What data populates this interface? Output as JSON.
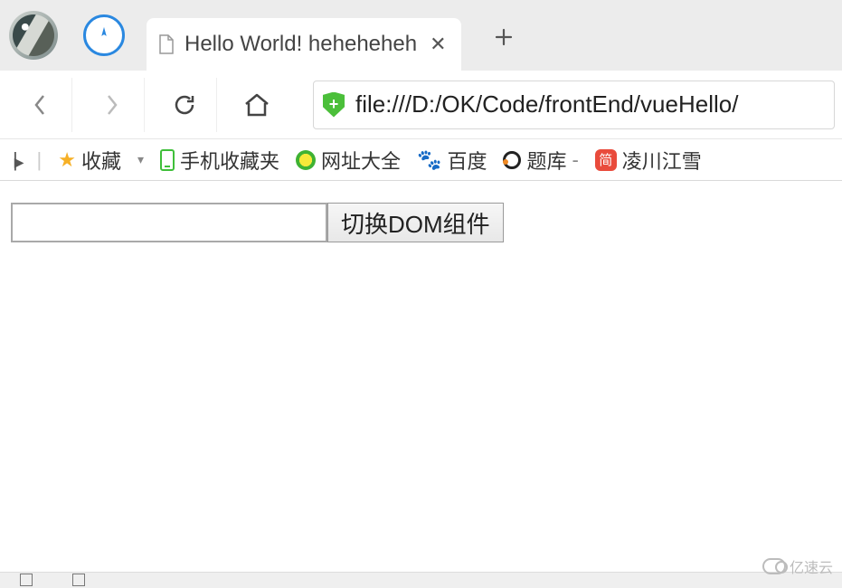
{
  "titleRow": {
    "tab": {
      "title": "Hello World! heheheheh"
    },
    "closeGlyph": "✕",
    "plusGlyph": "+"
  },
  "nav": {
    "url": "file:///D:/OK/Code/frontEnd/vueHello/",
    "shieldGlyph": "+"
  },
  "bookmarks": {
    "toggleGlyph": "▶",
    "favoritesLabel": "收藏",
    "chevGlyph": "▾",
    "mobileLabel": "手机收藏夹",
    "sitesLabel": "网址大全",
    "baiduLabel": "百度",
    "tikuLabel": "题库",
    "tikuSuffix": "-",
    "jianGlyph": "简",
    "lingchuanLabel": "凌川江雪"
  },
  "content": {
    "inputValue": "",
    "buttonLabel": "切换DOM组件"
  },
  "watermark": {
    "text": "亿速云"
  }
}
